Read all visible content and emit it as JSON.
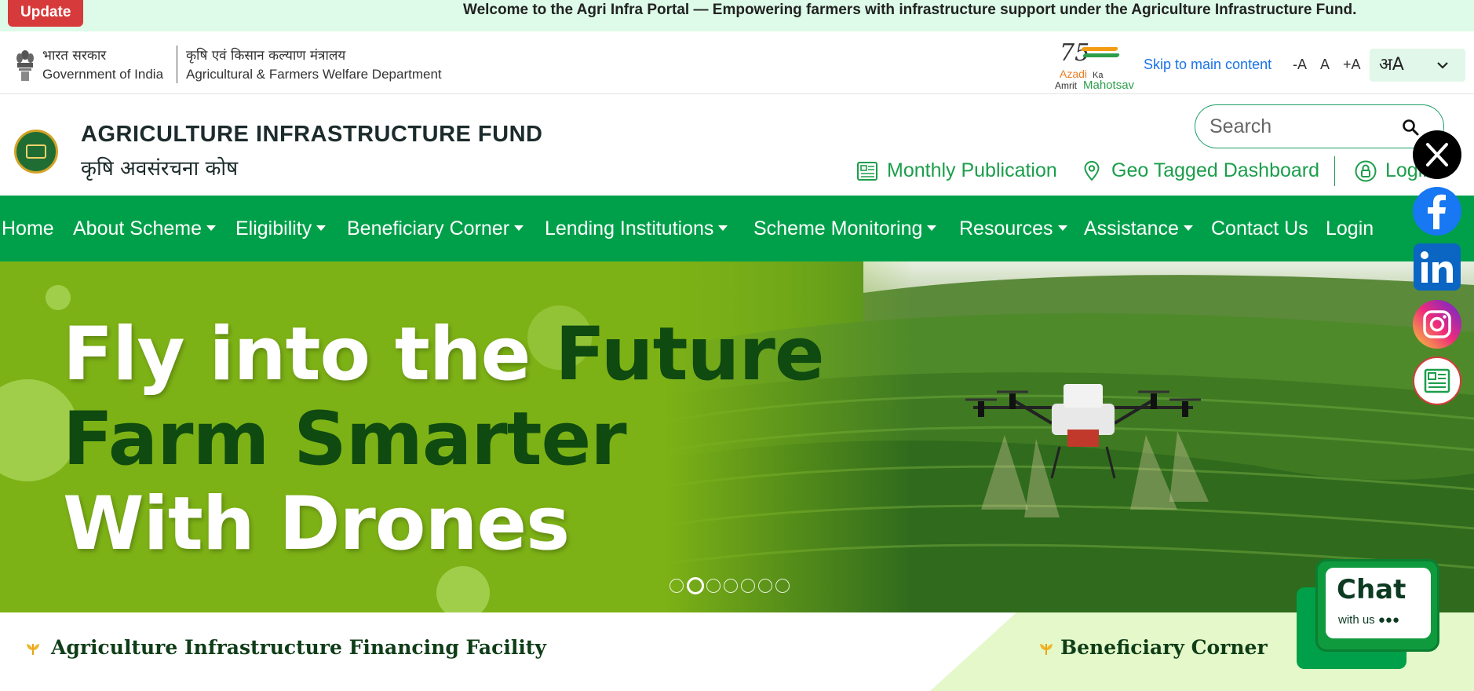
{
  "ticker": {
    "update_label": "Update",
    "message": "Welcome to the Agri Infra Portal — Empowering farmers with infrastructure support under the Agriculture Infrastructure Fund."
  },
  "gov_header": {
    "gov_hindi": "भारत सरकार",
    "gov_english": "Government of India",
    "dept_hindi": "कृषि एवं किसान कल्याण मंत्रालय",
    "dept_english": "Agricultural & Farmers Welfare Department",
    "azadi": {
      "number": "75",
      "line1": "Azadi",
      "line2": "Ka",
      "line3": "Amrit",
      "line4": "Mahotsav"
    },
    "skip_link": "Skip to main content",
    "font_decrease": "-A",
    "font_normal": "A",
    "font_increase": "+A",
    "language_glyph": "अA"
  },
  "brand": {
    "title": "AGRICULTURE INFRASTRUCTURE FUND",
    "subtitle": "कृषि अवसंरचना कोष",
    "search_placeholder": "Search",
    "quick_links": {
      "monthly_publication": "Monthly Publication",
      "geo_dashboard": "Geo Tagged Dashboard",
      "login": "Login"
    }
  },
  "nav": {
    "items": [
      {
        "label": "Home",
        "dropdown": false
      },
      {
        "label": "About Scheme",
        "dropdown": true
      },
      {
        "label": "Eligibility",
        "dropdown": true
      },
      {
        "label": "Beneficiary Corner",
        "dropdown": true
      },
      {
        "label": "Lending Institutions",
        "dropdown": true
      },
      {
        "label": "Scheme Monitoring",
        "dropdown": true
      },
      {
        "label": "Resources",
        "dropdown": true
      },
      {
        "label": "Assistance",
        "dropdown": true
      },
      {
        "label": "Contact Us",
        "dropdown": false
      },
      {
        "label": "Login",
        "dropdown": false
      }
    ]
  },
  "hero": {
    "line1_white": "Fly into the ",
    "line1_dark": "Future",
    "line2": "Farm Smarter",
    "line3": "With Drones",
    "slide_count": 7,
    "active_slide": 2
  },
  "sections": {
    "left_title": "Agriculture Infrastructure Financing Facility",
    "right_title": "Beneficiary Corner"
  },
  "chat": {
    "title": "Chat",
    "subtitle": "with us ●●●"
  },
  "social": [
    "x-icon",
    "facebook-icon",
    "linkedin-icon",
    "instagram-icon",
    "newspaper-icon"
  ],
  "colors": {
    "nav_green": "#00a04a",
    "link_green": "#1b9e4b",
    "ticker_bg": "#ddfbe8",
    "update_red": "#d73a3a",
    "hero_dark_text": "#0f4a10",
    "skip_link_blue": "#1a73e8"
  }
}
